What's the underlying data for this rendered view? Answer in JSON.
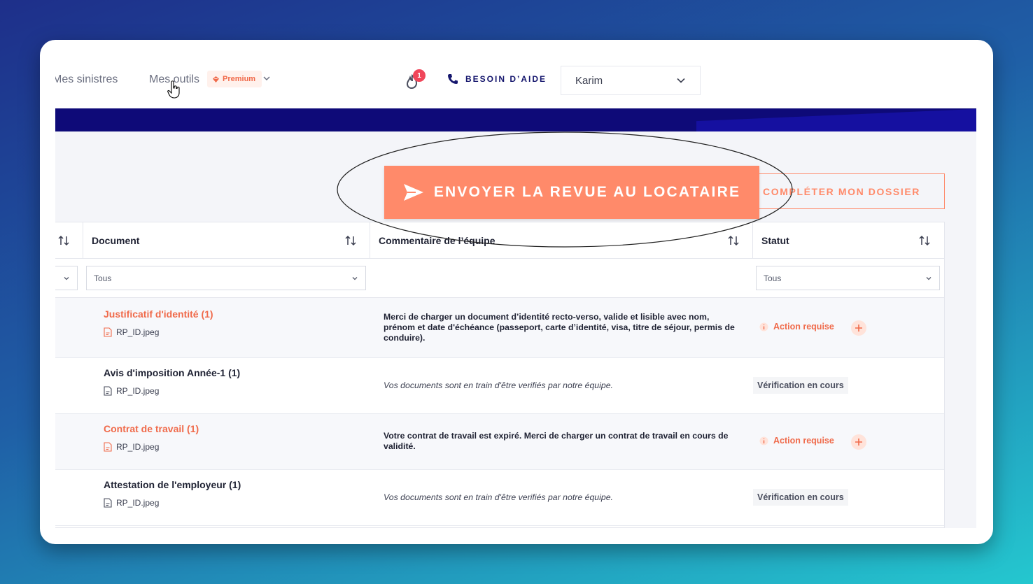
{
  "nav": {
    "sinistres": "Mes sinistres",
    "outils": "Mes outils",
    "premium_badge": "Premium",
    "notification_count": "1",
    "help": "BESOIN D’AIDE",
    "user": "Karim"
  },
  "actions": {
    "send_review": "ENVOYER LA REVUE AU LOCATAIRE",
    "complete_file": "COMPLÉTER MON DOSSIER"
  },
  "table": {
    "headers": {
      "document": "Document",
      "comment": "Commentaire de l’équipe",
      "status": "Statut"
    },
    "filters": {
      "document": "Tous",
      "status": "Tous"
    },
    "rows": [
      {
        "title": "Justificatif d'identité (1)",
        "file": "RP_ID.jpeg",
        "comment": "Merci de charger un document d’identité recto-verso, valide et lisible avec nom, prénom et date d'échéance (passeport, carte d’identité, visa, titre de séjour, permis de conduire).",
        "status": "Action requise"
      },
      {
        "title": "Avis d'imposition Année-1 (1)",
        "file": "RP_ID.jpeg",
        "comment": "Vos documents sont en train d'être verifiés par notre équipe.",
        "status": "Vérification en cours"
      },
      {
        "title": "Contrat de travail (1)",
        "file": "RP_ID.jpeg",
        "comment": "Votre contrat de travail est expiré. Merci de charger un contrat de travail en cours de validité.",
        "status": "Action requise"
      },
      {
        "title": "Attestation de l'employeur (1)",
        "file": "RP_ID.jpeg",
        "comment": "Vos documents sont en train d'être verifiés par notre équipe.",
        "status": "Vérification en cours"
      }
    ]
  },
  "colors": {
    "accent": "#ff8a6a",
    "warning": "#f06a4a",
    "navy": "#0e0a78",
    "notification": "#f0465a"
  },
  "icons": [
    "pointer-cursor-icon",
    "flame-icon",
    "phone-icon",
    "chevron-down-icon",
    "sort-icon",
    "send-icon",
    "file-icon",
    "info-icon",
    "plus-icon",
    "premium-gem-icon"
  ]
}
